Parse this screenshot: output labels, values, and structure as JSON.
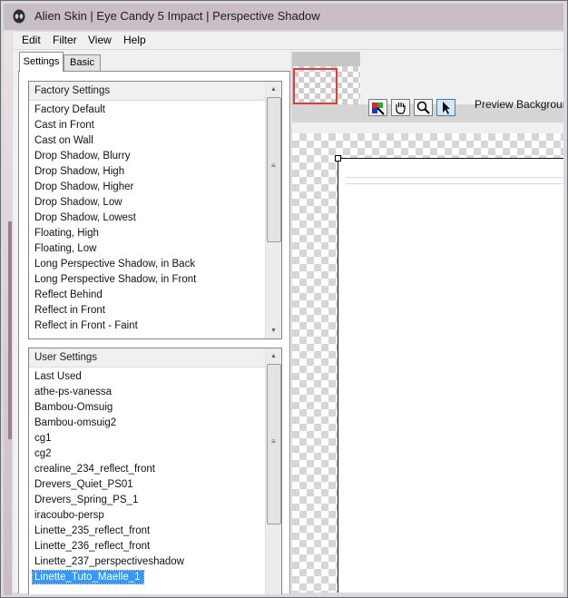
{
  "window": {
    "title": "Alien Skin | Eye Candy 5 Impact | Perspective Shadow"
  },
  "menu": {
    "items": [
      "Edit",
      "Filter",
      "View",
      "Help"
    ]
  },
  "tabs": {
    "settings": "Settings",
    "basic": "Basic"
  },
  "factory_settings": {
    "header": "Factory Settings",
    "items": [
      "Factory Default",
      "Cast in Front",
      "Cast on Wall",
      "Drop Shadow, Blurry",
      "Drop Shadow, High",
      "Drop Shadow, Higher",
      "Drop Shadow, Low",
      "Drop Shadow, Lowest",
      "Floating, High",
      "Floating, Low",
      "Long Perspective Shadow, in Back",
      "Long Perspective Shadow, in Front",
      "Reflect Behind",
      "Reflect in Front",
      "Reflect in Front - Faint"
    ]
  },
  "user_settings": {
    "header": "User Settings",
    "items": [
      "Last Used",
      "athe-ps-vanessa",
      "Bambou-Omsuig",
      "Bambou-omsuig2",
      "cg1",
      "cg2",
      "crealine_234_reflect_front",
      "Drevers_Quiet_PS01",
      "Drevers_Spring_PS_1",
      "iracoubo-persp",
      "Linette_235_reflect_front",
      "Linette_236_reflect_front",
      "Linette_237_perspectiveshadow",
      "Linette_Tuto_Maelle_1"
    ],
    "selected": "Linette_Tuto_Maelle_1"
  },
  "preview": {
    "label": "Preview Background",
    "tools": [
      "color-picker-icon",
      "hand-icon",
      "zoom-icon",
      "arrow-pointer-icon"
    ]
  },
  "colors": {
    "selection": "#3399ff",
    "thumbnail_frame": "#e63a3a"
  }
}
